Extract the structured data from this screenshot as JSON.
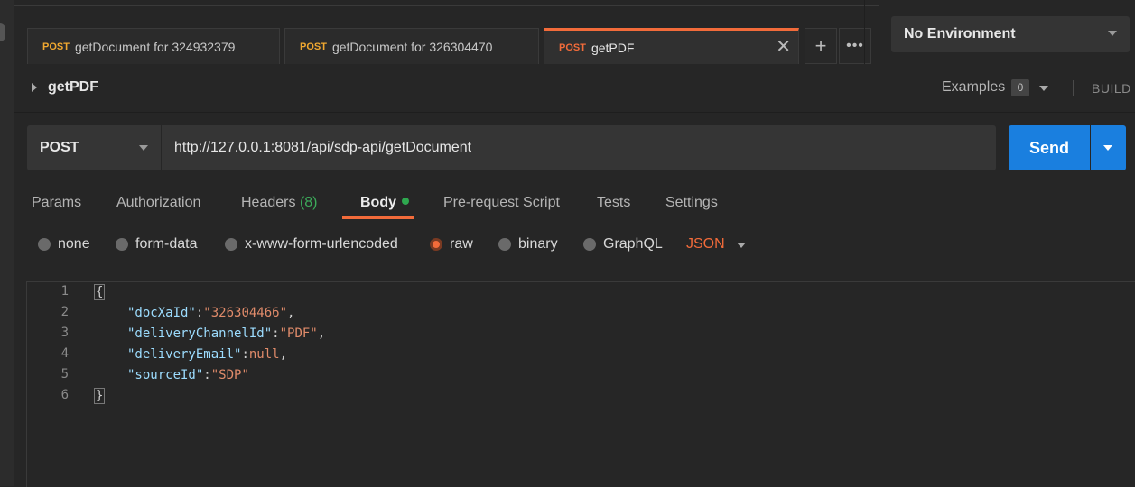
{
  "tabs": [
    {
      "method": "POST",
      "name": "getDocument for 324932379"
    },
    {
      "method": "POST",
      "name": "getDocument for 326304470"
    },
    {
      "method": "POST",
      "name": "getPDF"
    }
  ],
  "environment": "No Environment",
  "request": {
    "title": "getPDF",
    "examples_label": "Examples",
    "examples_count": "0",
    "build_label": "BUILD",
    "method": "POST",
    "url": "http://127.0.0.1:8081/api/sdp-api/getDocument",
    "send_label": "Send"
  },
  "request_tabs": [
    {
      "label": "Params"
    },
    {
      "label": "Authorization"
    },
    {
      "label": "Headers",
      "count": "(8)"
    },
    {
      "label": "Body"
    },
    {
      "label": "Pre-request Script"
    },
    {
      "label": "Tests"
    },
    {
      "label": "Settings"
    }
  ],
  "body_types": [
    "none",
    "form-data",
    "x-www-form-urlencoded",
    "raw",
    "binary",
    "GraphQL"
  ],
  "body_format": "JSON",
  "editor": {
    "line_numbers": [
      "1",
      "2",
      "3",
      "4",
      "5",
      "6"
    ],
    "open_brace": "{",
    "close_brace": "}",
    "lines": [
      {
        "key": "\"docXaId\"",
        "value": "\"326304466\"",
        "tail": ","
      },
      {
        "key": "\"deliveryChannelId\"",
        "value": "\"PDF\"",
        "tail": ","
      },
      {
        "key": "\"deliveryEmail\"",
        "value": "null",
        "tail": ","
      },
      {
        "key": "\"sourceId\"",
        "value": "\"SDP\"",
        "tail": ""
      }
    ]
  },
  "colors": {
    "accent": "#f26b3a",
    "send": "#1a7fdf",
    "method_tab": "#f0a830"
  }
}
